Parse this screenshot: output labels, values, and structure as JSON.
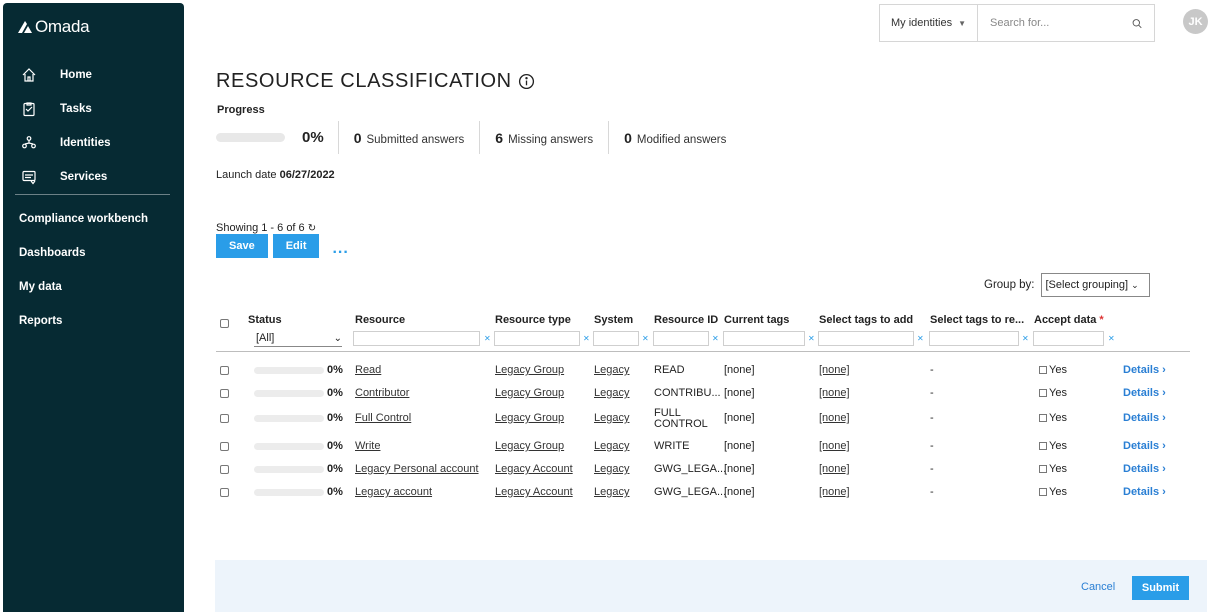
{
  "brand": {
    "name": "Omada"
  },
  "sidebar": {
    "main_items": [
      {
        "label": "Home",
        "icon": "home-icon"
      },
      {
        "label": "Tasks",
        "icon": "tasks-icon"
      },
      {
        "label": "Identities",
        "icon": "identities-icon"
      },
      {
        "label": "Services",
        "icon": "services-icon"
      }
    ],
    "secondary_items": [
      {
        "label": "Compliance workbench"
      },
      {
        "label": "Dashboards"
      },
      {
        "label": "My data"
      },
      {
        "label": "Reports"
      }
    ]
  },
  "header": {
    "selector_label": "My identities",
    "search_placeholder": "Search for...",
    "avatar_initials": "JK"
  },
  "page": {
    "title": "RESOURCE CLASSIFICATION",
    "progress_label": "Progress",
    "progress_value": 0,
    "progress_pct": "0%",
    "stats": [
      {
        "num": "0",
        "label": "Submitted answers"
      },
      {
        "num": "6",
        "label": "Missing answers"
      },
      {
        "num": "0",
        "label": "Modified answers"
      }
    ],
    "launch_label": "Launch date",
    "launch_date": "06/27/2022",
    "showing": "Showing 1 - 6 of 6",
    "save_label": "Save",
    "edit_label": "Edit",
    "more_label": "...",
    "group_by_label": "Group by:",
    "group_by_value": "[Select grouping]"
  },
  "table": {
    "headers": {
      "status": "Status",
      "resource": "Resource",
      "resource_type": "Resource type",
      "system": "System",
      "resource_id": "Resource ID",
      "current_tags": "Current tags",
      "tags_add": "Select tags to add",
      "tags_remove": "Select tags to re...",
      "accept": "Accept data",
      "required_mark": "*"
    },
    "status_filter": "[All]",
    "rows": [
      {
        "pct": "0%",
        "progress": 0,
        "resource": "Read",
        "type": "Legacy Group",
        "system": "Legacy",
        "rid": "READ",
        "tags": "[none]",
        "add": "[none]",
        "remove": "-",
        "accept": "Yes",
        "details": "Details"
      },
      {
        "pct": "0%",
        "progress": 0,
        "resource": "Contributor",
        "type": "Legacy Group",
        "system": "Legacy",
        "rid": "CONTRIBU...",
        "tags": "[none]",
        "add": "[none]",
        "remove": "-",
        "accept": "Yes",
        "details": "Details"
      },
      {
        "pct": "0%",
        "progress": 0,
        "resource": "Full Control",
        "type": "Legacy Group",
        "system": "Legacy",
        "rid": "FULL CONTROL",
        "tags": "[none]",
        "add": "[none]",
        "remove": "-",
        "accept": "Yes",
        "details": "Details"
      },
      {
        "pct": "0%",
        "progress": 0,
        "resource": "Write",
        "type": "Legacy Group",
        "system": "Legacy",
        "rid": "WRITE",
        "tags": "[none]",
        "add": "[none]",
        "remove": "-",
        "accept": "Yes",
        "details": "Details"
      },
      {
        "pct": "0%",
        "progress": 0,
        "resource": "Legacy Personal account",
        "type": "Legacy Account",
        "system": "Legacy",
        "rid": "GWG_LEGA...",
        "tags": "[none]",
        "add": "[none]",
        "remove": "-",
        "accept": "Yes",
        "details": "Details"
      },
      {
        "pct": "0%",
        "progress": 0,
        "resource": "Legacy account",
        "type": "Legacy Account",
        "system": "Legacy",
        "rid": "GWG_LEGA...",
        "tags": "[none]",
        "add": "[none]",
        "remove": "-",
        "accept": "Yes",
        "details": "Details"
      }
    ]
  },
  "footer": {
    "cancel_label": "Cancel",
    "submit_label": "Submit"
  },
  "colors": {
    "sidebar": "#062a33",
    "accent": "#2a9de8",
    "link": "#2a7fd4"
  }
}
